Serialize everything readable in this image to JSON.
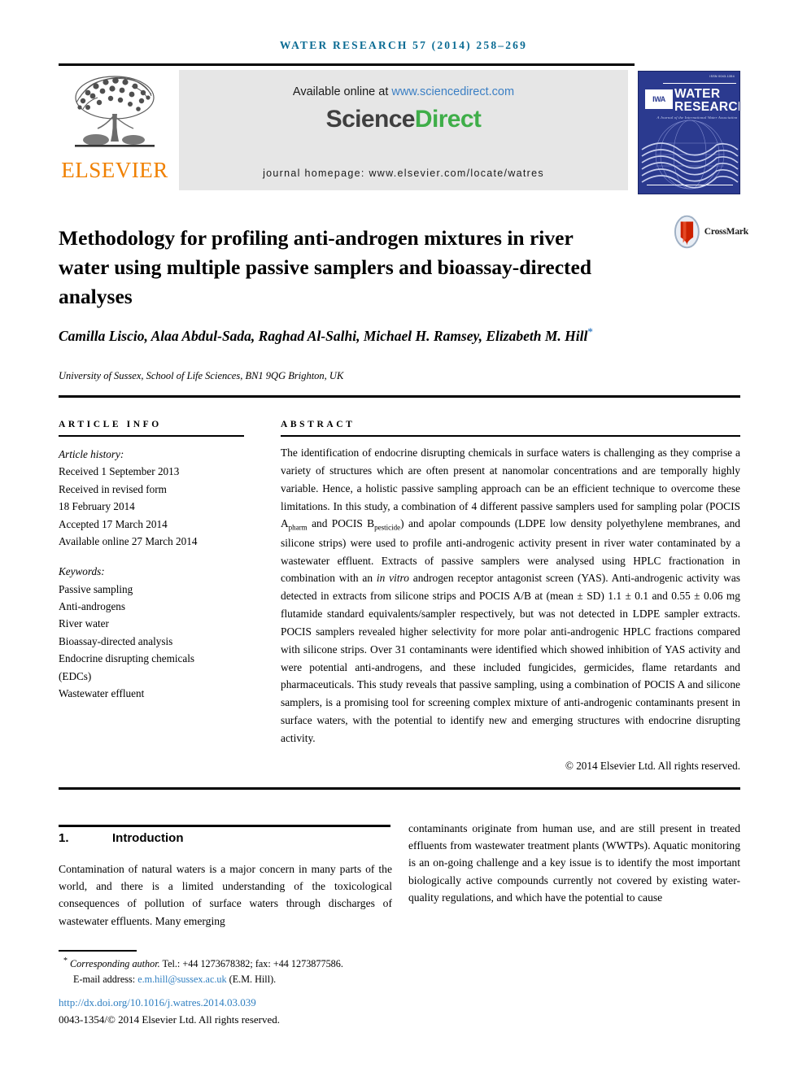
{
  "running_head": "WATER RESEARCH 57 (2014) 258–269",
  "masthead": {
    "publisher_name": "ELSEVIER",
    "available_prefix": "Available online at ",
    "available_url": "www.sciencedirect.com",
    "brand_first": "Science",
    "brand_second": "Direct",
    "journal_homepage": "journal homepage: www.elsevier.com/locate/watres",
    "cover": {
      "issn": "ISSN 0043-1354",
      "title_line1": "WATER",
      "title_line2": "RESEARCH",
      "society_logo": "IWA",
      "subtitle": "A Journal of the International Water Association"
    }
  },
  "article": {
    "title": "Methodology for profiling anti-androgen mixtures in river water using multiple passive samplers and bioassay-directed analyses",
    "crossmark_label": "CrossMark",
    "authors": "Camilla Liscio, Alaa Abdul-Sada, Raghad Al-Salhi, Michael H. Ramsey, Elizabeth M. Hill",
    "corresponding_marker": "*",
    "affiliation": "University of Sussex, School of Life Sciences, BN1 9QG Brighton, UK"
  },
  "info": {
    "heading": "ARTICLE INFO",
    "history_label": "Article history:",
    "history": [
      "Received 1 September 2013",
      "Received in revised form",
      "18 February 2014",
      "Accepted 17 March 2014",
      "Available online 27 March 2014"
    ],
    "keywords_label": "Keywords:",
    "keywords": [
      "Passive sampling",
      "Anti-androgens",
      "River water",
      "Bioassay-directed analysis",
      "Endocrine disrupting chemicals",
      "(EDCs)",
      "Wastewater effluent"
    ]
  },
  "abstract": {
    "heading": "ABSTRACT",
    "part1": "The identification of endocrine disrupting chemicals in surface waters is challenging as they comprise a variety of structures which are often present at nanomolar concentrations and are temporally highly variable. Hence, a holistic passive sampling approach can be an efficient technique to overcome these limitations. In this study, a combination of 4 different passive samplers used for sampling polar (POCIS A",
    "sub1": "pharm",
    "part2": " and POCIS B",
    "sub2": "pesticide",
    "part3": ") and apolar compounds (LDPE low density polyethylene membranes, and silicone strips) were used to profile anti-androgenic activity present in river water contaminated by a wastewater effluent. Extracts of passive samplers were analysed using HPLC fractionation in combination with an ",
    "italic1": "in vitro",
    "part4": " androgen receptor antagonist screen (YAS). Anti-androgenic activity was detected in extracts from silicone strips and POCIS A/B at (mean ± SD) 1.1 ± 0.1 and 0.55 ± 0.06 mg flutamide standard equivalents/sampler respectively, but was not detected in LDPE sampler extracts. POCIS samplers revealed higher selectivity for more polar anti-androgenic HPLC fractions compared with silicone strips. Over 31 contaminants were identified which showed inhibition of YAS activity and were potential anti-androgens, and these included fungicides, germicides, flame retardants and pharmaceuticals. This study reveals that passive sampling, using a combination of POCIS A and silicone samplers, is a promising tool for screening complex mixture of anti-androgenic contaminants present in surface waters, with the potential to identify new and emerging structures with endocrine disrupting activity.",
    "copyright": "© 2014 Elsevier Ltd. All rights reserved."
  },
  "body": {
    "section_number": "1.",
    "section_title": "Introduction",
    "column_left": "Contamination of natural waters is a major concern in many parts of the world, and there is a limited understanding of the toxicological consequences of pollution of surface waters through discharges of wastewater effluents. Many emerging",
    "column_right": "contaminants originate from human use, and are still present in treated effluents from wastewater treatment plants (WWTPs). Aquatic monitoring is an on-going challenge and a key issue is to identify the most important biologically active compounds currently not covered by existing water-quality regulations, and which have the potential to cause"
  },
  "footnote": {
    "marker": "*",
    "corresponding": "Corresponding author.",
    "contact": " Tel.: +44 1273678382; fax: +44 1273877586.",
    "email_label": "E-mail address: ",
    "email": "e.m.hill@sussex.ac.uk",
    "email_owner": " (E.M. Hill).",
    "doi": "http://dx.doi.org/10.1016/j.watres.2014.03.039",
    "issn_line": "0043-1354/© 2014 Elsevier Ltd. All rights reserved."
  },
  "colors": {
    "journal_teal": "#0a6b93",
    "link_blue": "#3b7fc4",
    "sciencedirect_green": "#3fae49",
    "elsevier_orange": "#f08000",
    "cover_blue": "#2b3a8f"
  }
}
